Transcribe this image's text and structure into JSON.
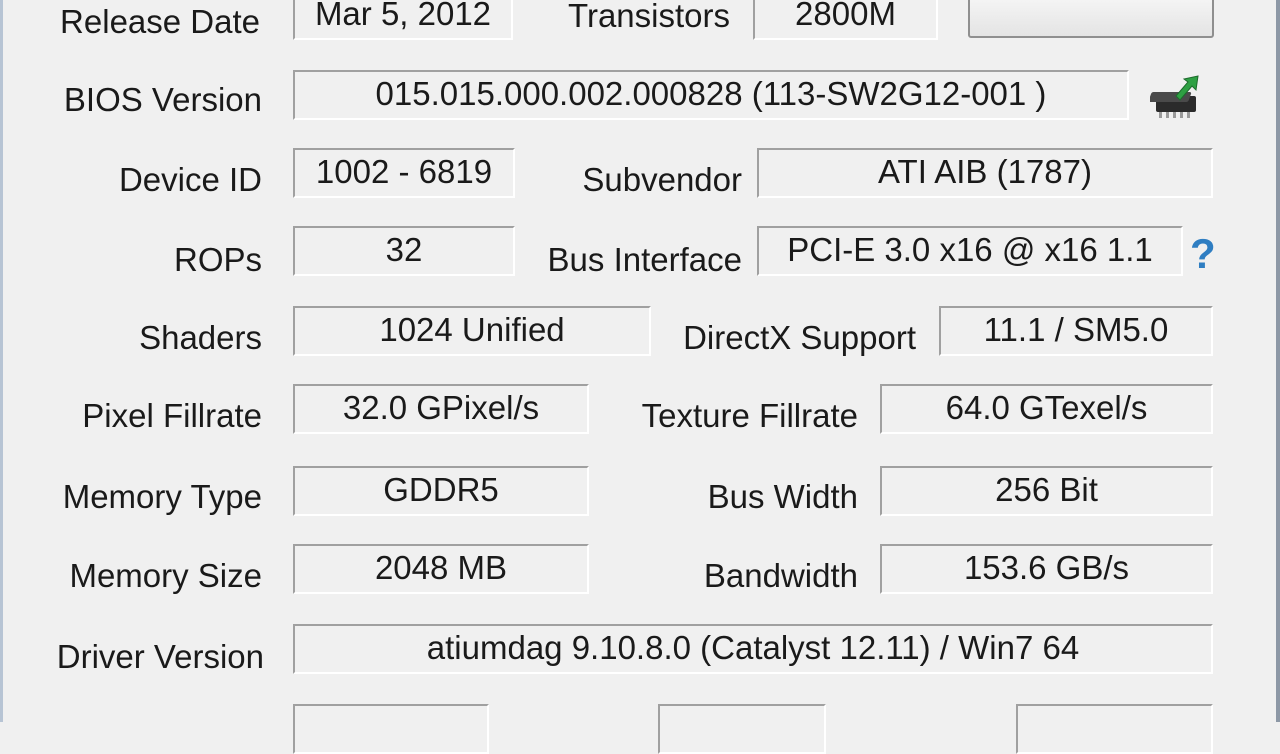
{
  "rows": {
    "release_date": {
      "label": "Release Date",
      "value": "Mar 5, 2012"
    },
    "transistors": {
      "label": "Transistors",
      "value": "2800M"
    },
    "bios_version": {
      "label": "BIOS Version",
      "value": "015.015.000.002.000828 (113-SW2G12-001  )"
    },
    "device_id": {
      "label": "Device ID",
      "value": "1002 - 6819"
    },
    "subvendor": {
      "label": "Subvendor",
      "value": "ATI AIB (1787)"
    },
    "rops": {
      "label": "ROPs",
      "value": "32"
    },
    "bus_interface": {
      "label": "Bus Interface",
      "value": "PCI-E 3.0 x16 @ x16 1.1"
    },
    "shaders": {
      "label": "Shaders",
      "value": "1024 Unified"
    },
    "directx_support": {
      "label": "DirectX Support",
      "value": "11.1 / SM5.0"
    },
    "pixel_fillrate": {
      "label": "Pixel Fillrate",
      "value": "32.0 GPixel/s"
    },
    "texture_fillrate": {
      "label": "Texture Fillrate",
      "value": "64.0 GTexel/s"
    },
    "memory_type": {
      "label": "Memory Type",
      "value": "GDDR5"
    },
    "bus_width": {
      "label": "Bus Width",
      "value": "256 Bit"
    },
    "memory_size": {
      "label": "Memory Size",
      "value": "2048 MB"
    },
    "bandwidth": {
      "label": "Bandwidth",
      "value": "153.6 GB/s"
    },
    "driver_version": {
      "label": "Driver Version",
      "value": "atiumdag 9.10.8.0 (Catalyst 12.11) / Win7 64"
    }
  },
  "bus_help": "?",
  "icons": {
    "bios_save": "chip-save-icon",
    "bus_help": "question-mark-icon"
  },
  "colors": {
    "help": "#2f7ec2",
    "chip_arrow": "#2ea043"
  }
}
